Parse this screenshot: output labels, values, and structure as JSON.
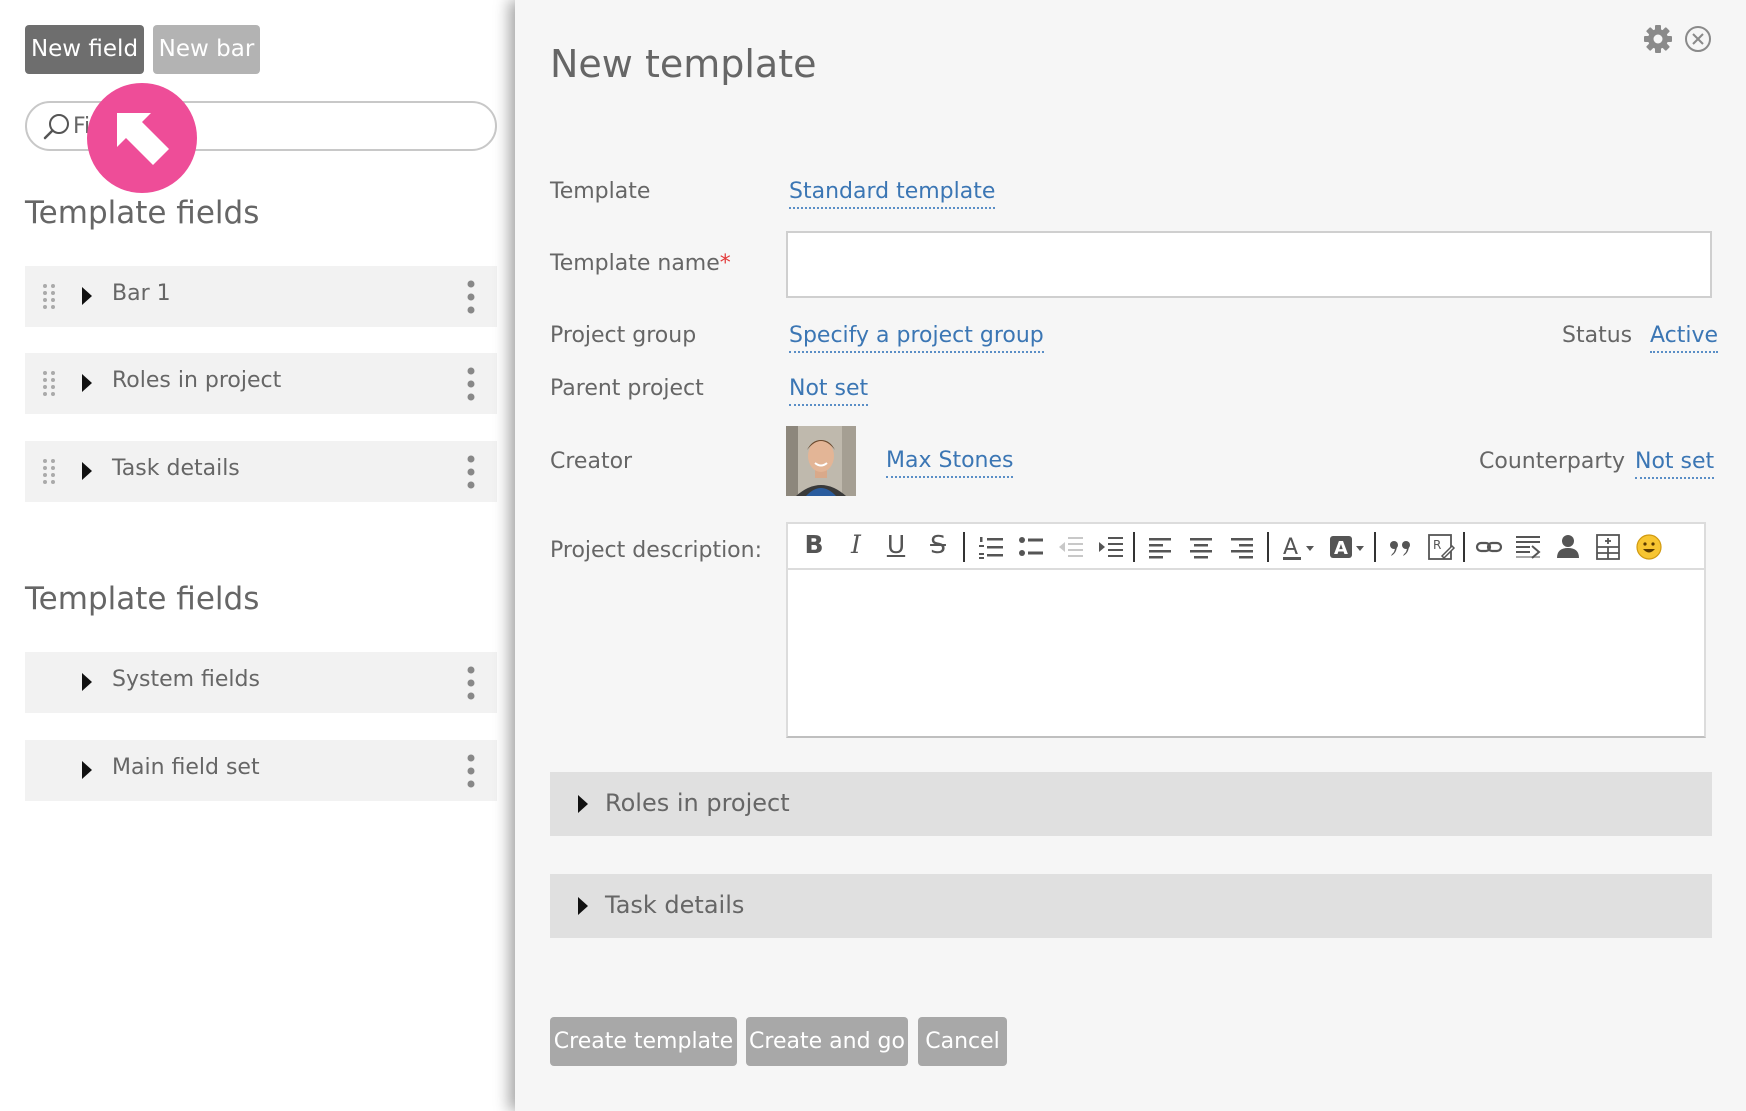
{
  "left_panel": {
    "new_field_label": "New field",
    "new_bar_label": "New bar",
    "search": {
      "value": "Fi",
      "placeholder": ""
    },
    "sections": [
      {
        "title": "Template fields",
        "items": [
          "Bar 1",
          "Roles in project",
          "Task details"
        ]
      },
      {
        "title": "Template fields",
        "items": [
          "System fields",
          "Main field set"
        ]
      }
    ]
  },
  "modal": {
    "title": "New template",
    "fields": {
      "template_label": "Template",
      "template_value": "Standard template",
      "template_name_label": "Template name",
      "required_mark": "*",
      "template_name_value": "",
      "project_group_label": "Project group",
      "project_group_value": "Specify a project group",
      "status_label": "Status",
      "status_value": "Active",
      "parent_project_label": "Parent project",
      "parent_project_value": "Not set",
      "creator_label": "Creator",
      "creator_value": "Max Stones",
      "counterparty_label": "Counterparty",
      "counterparty_value": "Not set",
      "description_label": "Project description:"
    },
    "editor_toolbar": [
      "bold-icon",
      "italic-icon",
      "underline-icon",
      "strikethrough-icon",
      "numbered-list-icon",
      "bullet-list-icon",
      "outdent-icon",
      "indent-icon",
      "align-left-icon",
      "align-center-icon",
      "align-right-icon",
      "text-color-icon",
      "background-color-icon",
      "blockquote-icon",
      "template-icon",
      "link-icon",
      "source-icon",
      "user-icon",
      "table-icon",
      "emoji-icon"
    ],
    "bars": [
      "Roles in project",
      "Task details"
    ],
    "buttons": {
      "create": "Create template",
      "create_go": "Create and go",
      "cancel": "Cancel"
    }
  },
  "colors": {
    "accent_link": "#3b76b4",
    "cursor_badge": "#ee4d98",
    "primary_button": "#6e6e6e",
    "disabled_button": "#a8a8a8"
  }
}
